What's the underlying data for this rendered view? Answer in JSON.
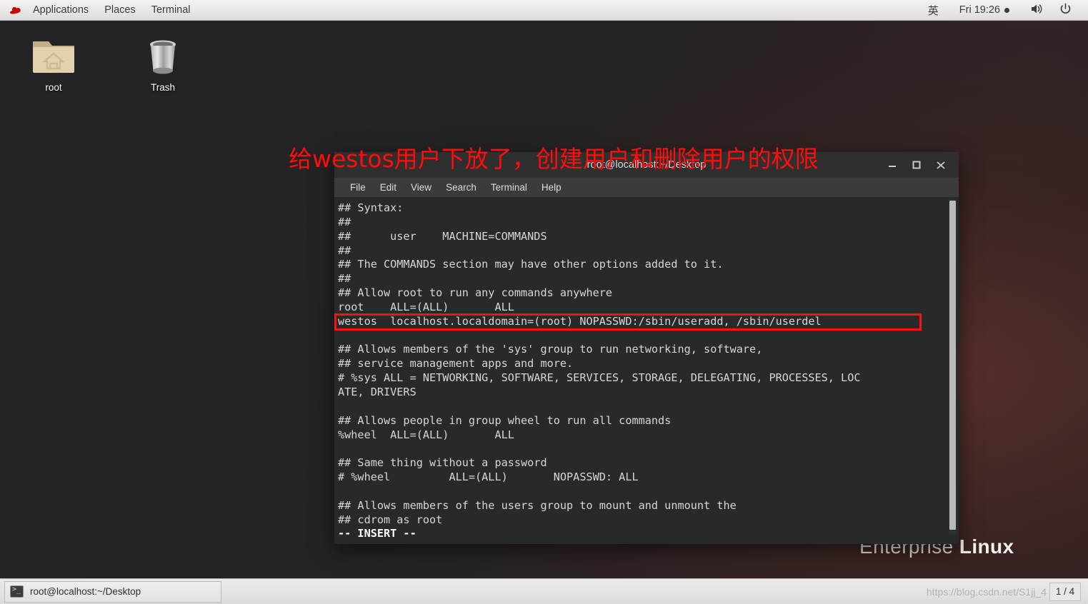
{
  "top_panel": {
    "logo_icon": "redhat-logo-icon",
    "menus": [
      "Applications",
      "Places",
      "Terminal"
    ],
    "input_method": "英",
    "clock": "Fri 19:26",
    "clock_dot_icon": "notification-dot-icon",
    "volume_icon": "speaker-icon",
    "power_icon": "power-icon"
  },
  "desktop": {
    "icons": [
      {
        "label": "root",
        "icon": "home-folder-icon"
      },
      {
        "label": "Trash",
        "icon": "trash-can-icon"
      }
    ],
    "annotation": "给westos用户下放了，创建用户和删除用户的权限",
    "annotation_color": "#ff0d0d",
    "wallpaper_brand_thin": "Enterprise",
    "wallpaper_brand_bold": "Linux"
  },
  "terminal": {
    "title": "root@localhost:~/Desktop",
    "window_buttons": {
      "minimize": "minimize-icon",
      "maximize": "maximize-icon",
      "close": "close-icon"
    },
    "menubar": [
      "File",
      "Edit",
      "View",
      "Search",
      "Terminal",
      "Help"
    ],
    "background": "#262a2b",
    "foreground": "#d6d6d6",
    "highlight_color": "#ff1010",
    "lines": [
      "## Syntax:",
      "##",
      "##      user    MACHINE=COMMANDS",
      "##",
      "## The COMMANDS section may have other options added to it.",
      "##",
      "## Allow root to run any commands anywhere",
      "root    ALL=(ALL)       ALL",
      "westos  localhost.localdomain=(root) NOPASSWD:/sbin/useradd, /sbin/userdel",
      "",
      "## Allows members of the 'sys' group to run networking, software,",
      "## service management apps and more.",
      "# %sys ALL = NETWORKING, SOFTWARE, SERVICES, STORAGE, DELEGATING, PROCESSES, LOC",
      "ATE, DRIVERS",
      "",
      "## Allows people in group wheel to run all commands",
      "%wheel  ALL=(ALL)       ALL",
      "",
      "## Same thing without a password",
      "# %wheel         ALL=(ALL)       NOPASSWD: ALL",
      "",
      "## Allows members of the users group to mount and unmount the",
      "## cdrom as root"
    ],
    "status_line": "-- INSERT --",
    "highlighted_line_index": 8,
    "scrollbar": "vertical-scrollbar"
  },
  "taskbar": {
    "task_label": "root@localhost:~/Desktop",
    "task_icon": "terminal-icon",
    "workspace": "1 / 4",
    "watermark": "https://blog.csdn.net/S1jj_4"
  }
}
